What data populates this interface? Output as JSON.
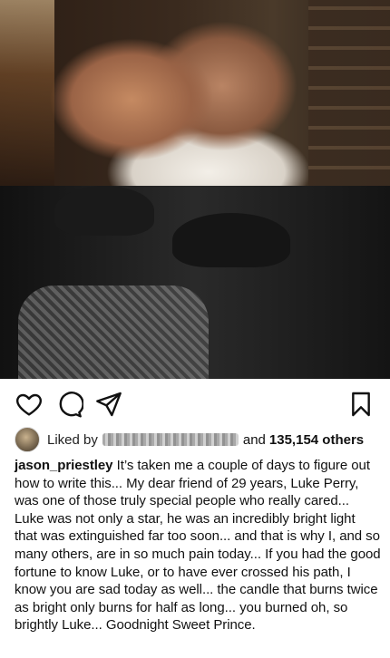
{
  "post": {
    "photos": [
      {
        "alt": ""
      },
      {
        "alt": ""
      }
    ],
    "actions": {
      "like_icon": "heart-outline-icon",
      "comment_icon": "comment-bubble-icon",
      "share_icon": "paper-plane-icon",
      "save_icon": "bookmark-outline-icon"
    },
    "likes": {
      "prefix": "Liked by",
      "user_redacted": true,
      "connector": "and",
      "count_text": "135,154 others"
    },
    "caption": {
      "username": "jason_priestley",
      "text": "It’s taken me a couple of days to figure out how to write this... My dear friend of 29 years, Luke Perry, was one of those truly special people who really cared... Luke was not only a star, he was an incredibly bright light that was extinguished far too soon... and that is why I, and so many others, are in so much pain today... If you had the good fortune to know Luke, or to have ever crossed his path, I know you are sad today as well... the candle that burns twice as bright only burns for half as long... you burned oh, so brightly Luke... Goodnight Sweet Prince."
    }
  }
}
